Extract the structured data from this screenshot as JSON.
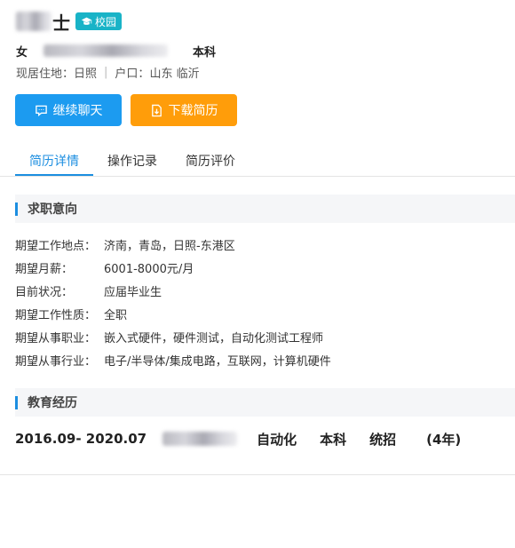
{
  "profile": {
    "name_suffix": "士",
    "campus_badge": "校园",
    "gender": "女",
    "education": "本科",
    "residence_label": "现居住地：",
    "residence_value": "日照",
    "hukou_label": "户口：",
    "hukou_value": "山东 临沂"
  },
  "actions": {
    "chat_label": "继续聊天",
    "download_label": "下载简历"
  },
  "tabs": [
    {
      "label": "简历详情",
      "active": true
    },
    {
      "label": "操作记录",
      "active": false
    },
    {
      "label": "简历评价",
      "active": false
    }
  ],
  "job_intent": {
    "title": "求职意向",
    "fields": [
      {
        "label": "期望工作地点：",
        "value": "济南，青岛，日照-东港区"
      },
      {
        "label": "期望月薪：",
        "value": "6001-8000元/月"
      },
      {
        "label": "目前状况：",
        "value": "应届毕业生"
      },
      {
        "label": "期望工作性质：",
        "value": "全职"
      },
      {
        "label": "期望从事职业：",
        "value": "嵌入式硬件，硬件测试，自动化测试工程师"
      },
      {
        "label": "期望从事行业：",
        "value": "电子/半导体/集成电路，互联网，计算机硬件"
      }
    ]
  },
  "education_history": {
    "title": "教育经历",
    "entries": [
      {
        "period": "2016.09-  2020.07",
        "major": "自动化",
        "degree": "本科",
        "type": "统招",
        "years": "(4年)"
      }
    ]
  },
  "colors": {
    "primary": "#1c8ee0",
    "chat_button": "#1c9bf0",
    "download_button": "#ff9d0a",
    "campus_badge": "#19b3c7"
  }
}
